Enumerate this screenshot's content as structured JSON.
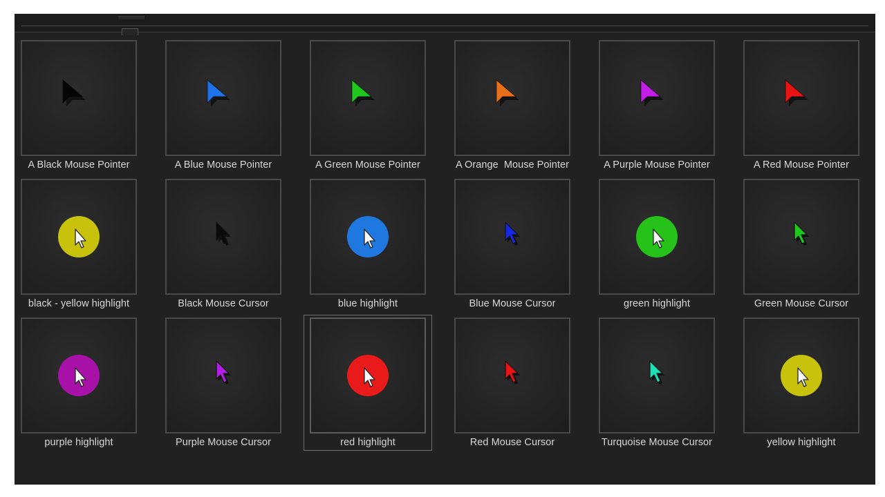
{
  "gallery": {
    "items": [
      {
        "label": "A Black Mouse Pointer",
        "icon": "black-pointer-icon",
        "kind": "pointer",
        "color": "#050505"
      },
      {
        "label": "A Blue Mouse Pointer",
        "icon": "blue-pointer-icon",
        "kind": "pointer",
        "color": "#1e73e8"
      },
      {
        "label": "A Green Mouse Pointer",
        "icon": "green-pointer-icon",
        "kind": "pointer",
        "color": "#1ec81e"
      },
      {
        "label": "A Orange  Mouse Pointer",
        "icon": "orange-pointer-icon",
        "kind": "pointer",
        "color": "#e8701a"
      },
      {
        "label": "A Purple Mouse Pointer",
        "icon": "purple-pointer-icon",
        "kind": "pointer",
        "color": "#c21ee8"
      },
      {
        "label": "A Red Mouse Pointer",
        "icon": "red-pointer-icon",
        "kind": "pointer",
        "color": "#e81414"
      },
      {
        "label": "black - yellow highlight",
        "icon": "yellow-highlight-cursor-icon",
        "kind": "highlight",
        "color": "#c9c20c"
      },
      {
        "label": "Black Mouse Cursor",
        "icon": "black-cursor-icon",
        "kind": "cursor",
        "color": "#0a0a0a"
      },
      {
        "label": "blue highlight",
        "icon": "blue-highlight-cursor-icon",
        "kind": "highlight",
        "color": "#1e78e0"
      },
      {
        "label": "Blue Mouse Cursor",
        "icon": "blue-cursor-icon",
        "kind": "cursor",
        "color": "#1428e6"
      },
      {
        "label": "green highlight",
        "icon": "green-highlight-cursor-icon",
        "kind": "highlight",
        "color": "#26c21a"
      },
      {
        "label": "Green Mouse Cursor",
        "icon": "green-cursor-icon",
        "kind": "cursor",
        "color": "#1ec81e"
      },
      {
        "label": "purple highlight",
        "icon": "purple-highlight-cursor-icon",
        "kind": "highlight",
        "color": "#a812a8"
      },
      {
        "label": "Purple Mouse Cursor",
        "icon": "purple-cursor-icon",
        "kind": "cursor",
        "color": "#b41ee8"
      },
      {
        "label": "red highlight",
        "icon": "red-highlight-cursor-icon",
        "kind": "highlight",
        "color": "#e81a1a",
        "selected": true
      },
      {
        "label": "Red Mouse Cursor",
        "icon": "red-cursor-icon",
        "kind": "cursor",
        "color": "#e81414"
      },
      {
        "label": "Turquoise Mouse Cursor",
        "icon": "turquoise-cursor-icon",
        "kind": "cursor",
        "color": "#1ee0b4"
      },
      {
        "label": "yellow highlight",
        "icon": "yellow-highlight-cursor-icon",
        "kind": "highlight",
        "color": "#c9c20c"
      }
    ]
  }
}
